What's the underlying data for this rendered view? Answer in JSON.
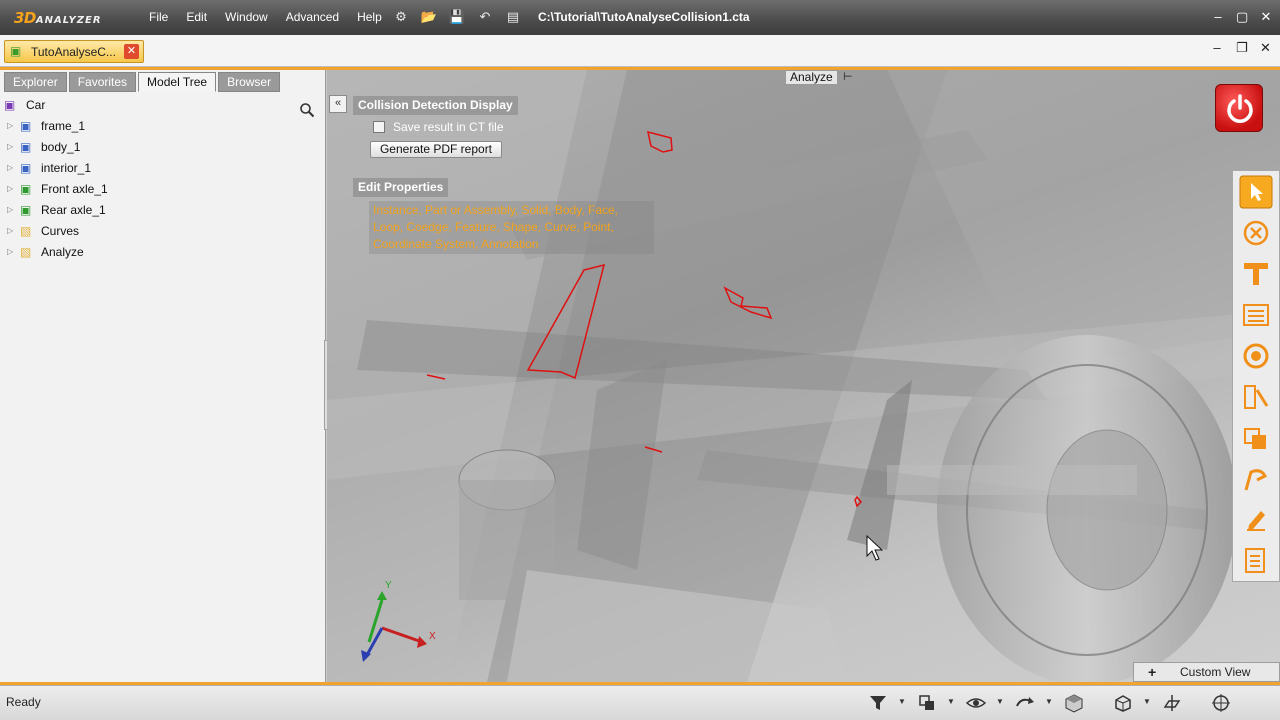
{
  "app": {
    "logo_3d": "3D",
    "logo_name": "ANALYZER",
    "menu": [
      "File",
      "Edit",
      "Window",
      "Advanced",
      "Help"
    ],
    "file_path": "C:\\Tutorial\\TutoAnalyseCollision1.cta"
  },
  "document_tab": {
    "name": "TutoAnalyseC..."
  },
  "left_panel": {
    "tabs": [
      "Explorer",
      "Favorites",
      "Model Tree",
      "Browser"
    ],
    "active_tab": "Model Tree",
    "tree": [
      {
        "label": "Car",
        "icon": "assembly-root-icon"
      },
      {
        "label": "frame_1",
        "icon": "part-icon"
      },
      {
        "label": "body_1",
        "icon": "part-icon"
      },
      {
        "label": "interior_1",
        "icon": "part-icon"
      },
      {
        "label": "Front axle_1",
        "icon": "assembly-icon"
      },
      {
        "label": "Rear axle_1",
        "icon": "assembly-icon"
      },
      {
        "label": "Curves",
        "icon": "folder-icon"
      },
      {
        "label": "Analyze",
        "icon": "folder-icon"
      }
    ]
  },
  "overlay": {
    "collision_title": "Collision Detection Display",
    "save_result_label": "Save result in CT file",
    "save_result_checked": false,
    "pdf_button": "Generate PDF report",
    "edit_properties_title": "Edit Properties",
    "edit_properties_text": "Instance, Part or Assembly, Solid, Body, Face, Loop, Coedge, Feature, Shape, Curve, Point, Coordinate System, Annotation"
  },
  "viewport": {
    "analyze_label": "Analyze",
    "custom_view_label": "Custom View",
    "axis_x": "X",
    "axis_y": "Y",
    "colors": {
      "collision_highlight": "#e01010",
      "accent": "#f0a42c"
    }
  },
  "toolstrip": [
    "select-icon",
    "cancel-icon",
    "measure-icon",
    "list-icon",
    "clearance-icon",
    "analyze-tool-icon",
    "compare-icon",
    "markup-icon",
    "edit-icon",
    "report-icon"
  ],
  "statusbar": {
    "status": "Ready"
  }
}
